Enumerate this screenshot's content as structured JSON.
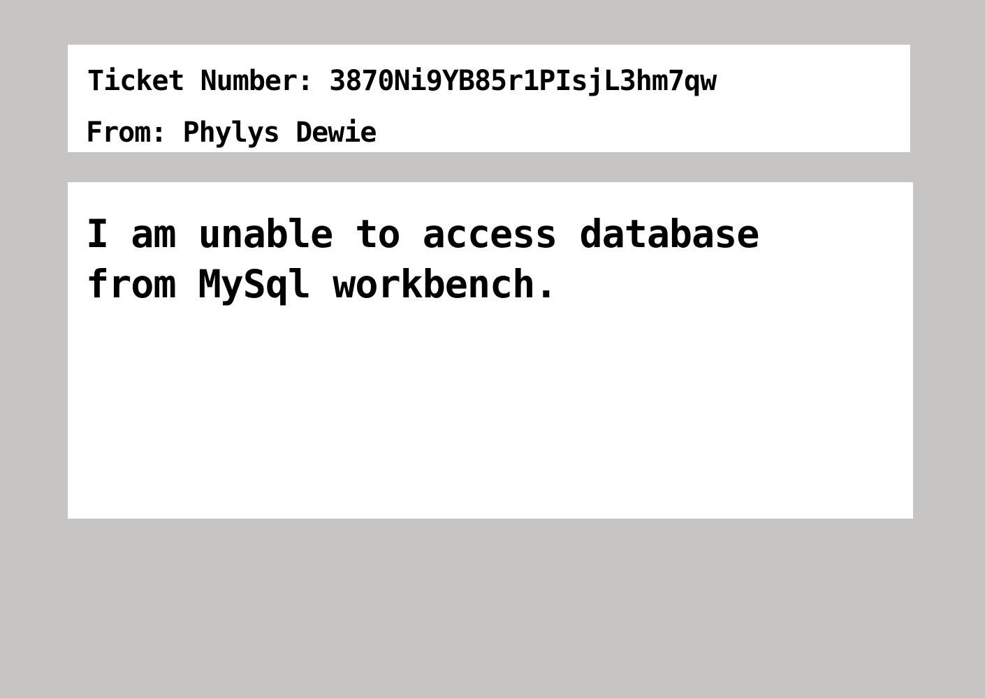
{
  "ticket": {
    "number_label": "Ticket Number: 3870Ni9YB85r1PIsjL3hm7qw",
    "from_label": "From: Phylys Dewie"
  },
  "message": {
    "body": "I am unable to access database from MySql workbench."
  }
}
